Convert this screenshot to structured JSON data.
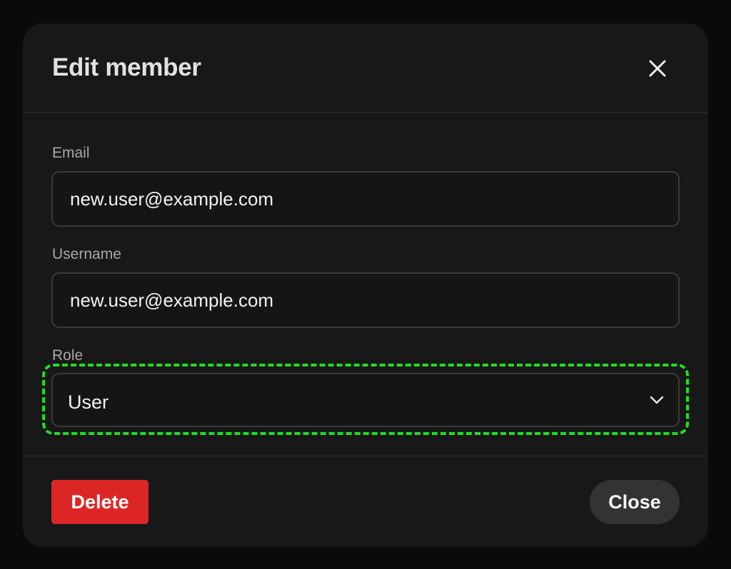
{
  "dialog": {
    "title": "Edit member",
    "close_icon": "close-icon"
  },
  "form": {
    "email": {
      "label": "Email",
      "value": "new.user@example.com"
    },
    "username": {
      "label": "Username",
      "value": "new.user@example.com"
    },
    "role": {
      "label": "Role",
      "selected": "User",
      "icon": "chevron-down-icon"
    }
  },
  "footer": {
    "delete_label": "Delete",
    "close_label": "Close"
  },
  "colors": {
    "backdrop": "#0a0a0a",
    "modal_bg": "#181818",
    "danger": "#dc2626",
    "secondary_button": "#333333",
    "focus_highlight": "#22dd22"
  }
}
